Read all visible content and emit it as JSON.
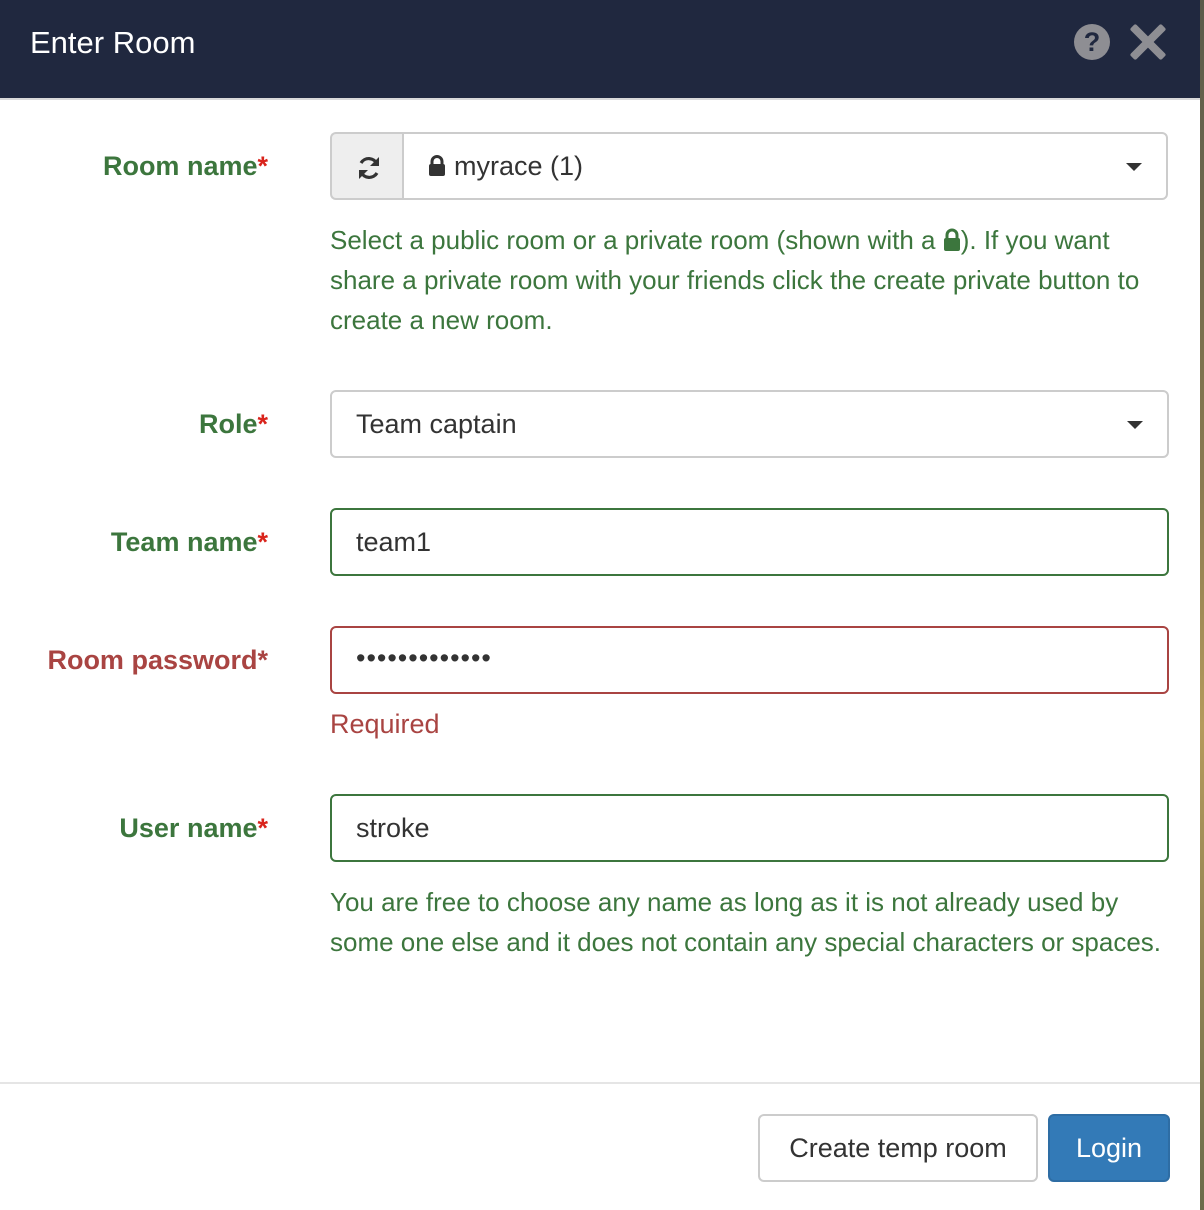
{
  "dialog": {
    "title": "Enter Room",
    "help_icon_glyph": "?"
  },
  "form": {
    "room_name": {
      "label": "Room name",
      "required_mark": "*",
      "selected": "myrace (1)",
      "selected_is_private": true,
      "help_before_lock": "Select a public room or a private room (shown with a ",
      "help_after_lock": "). If you want share a private room with your friends click the create private button to create a new room."
    },
    "role": {
      "label": "Role",
      "required_mark": "*",
      "selected": "Team captain"
    },
    "team_name": {
      "label": "Team name",
      "required_mark": "*",
      "value": "team1"
    },
    "room_password": {
      "label": "Room password",
      "required_mark": "*",
      "masked_value": "•••••••••••••",
      "error": "Required"
    },
    "user_name": {
      "label": "User name",
      "required_mark": "*",
      "value": "stroke",
      "help": "You are free to choose any name as long as it is not already used by some one else and it does not contain any special characters or spaces."
    }
  },
  "footer": {
    "create_temp_room_label": "Create temp room",
    "login_label": "Login"
  },
  "colors": {
    "header_bg": "#20283f",
    "success": "#3c763d",
    "error": "#a94442",
    "required_star": "#d9241c",
    "primary": "#337ab7"
  }
}
